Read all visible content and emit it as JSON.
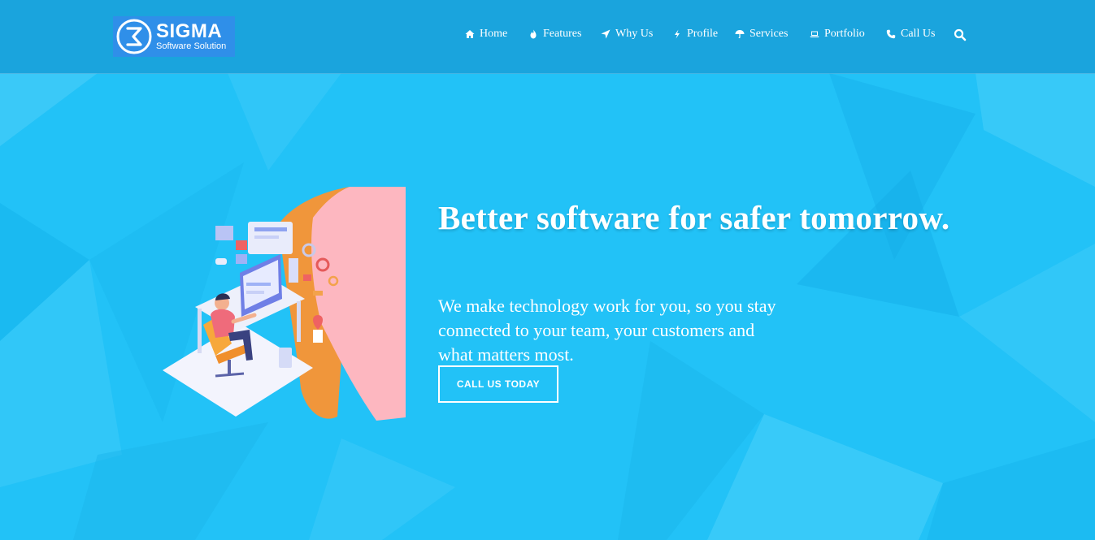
{
  "brand": {
    "name": "SIGMA",
    "tagline": "Software Solution",
    "logo_icon": "sigma-logo-icon",
    "color": "#2f8fe9"
  },
  "nav": {
    "items": [
      {
        "label": "Home",
        "icon": "home-icon"
      },
      {
        "label": "Features",
        "icon": "flame-icon"
      },
      {
        "label": "Why Us",
        "icon": "location-arrow-icon"
      },
      {
        "label": "Profile",
        "icon": "bolt-icon"
      },
      {
        "label": "Services",
        "icon": "umbrella-icon"
      },
      {
        "label": "Portfolio",
        "icon": "laptop-icon"
      },
      {
        "label": "Call Us",
        "icon": "phone-icon"
      }
    ],
    "search_icon": "search-icon"
  },
  "hero": {
    "headline": "Better software for safer tomorrow.",
    "subtext": "We make technology work for you, so you stay connected to your team, your customers and what matters most.",
    "cta_label": "CALL US TODAY",
    "illustration": "developer-workstation-illustration"
  },
  "colors": {
    "background": "#22c2f7",
    "header": "#1a9ad6",
    "text": "#ffffff"
  }
}
